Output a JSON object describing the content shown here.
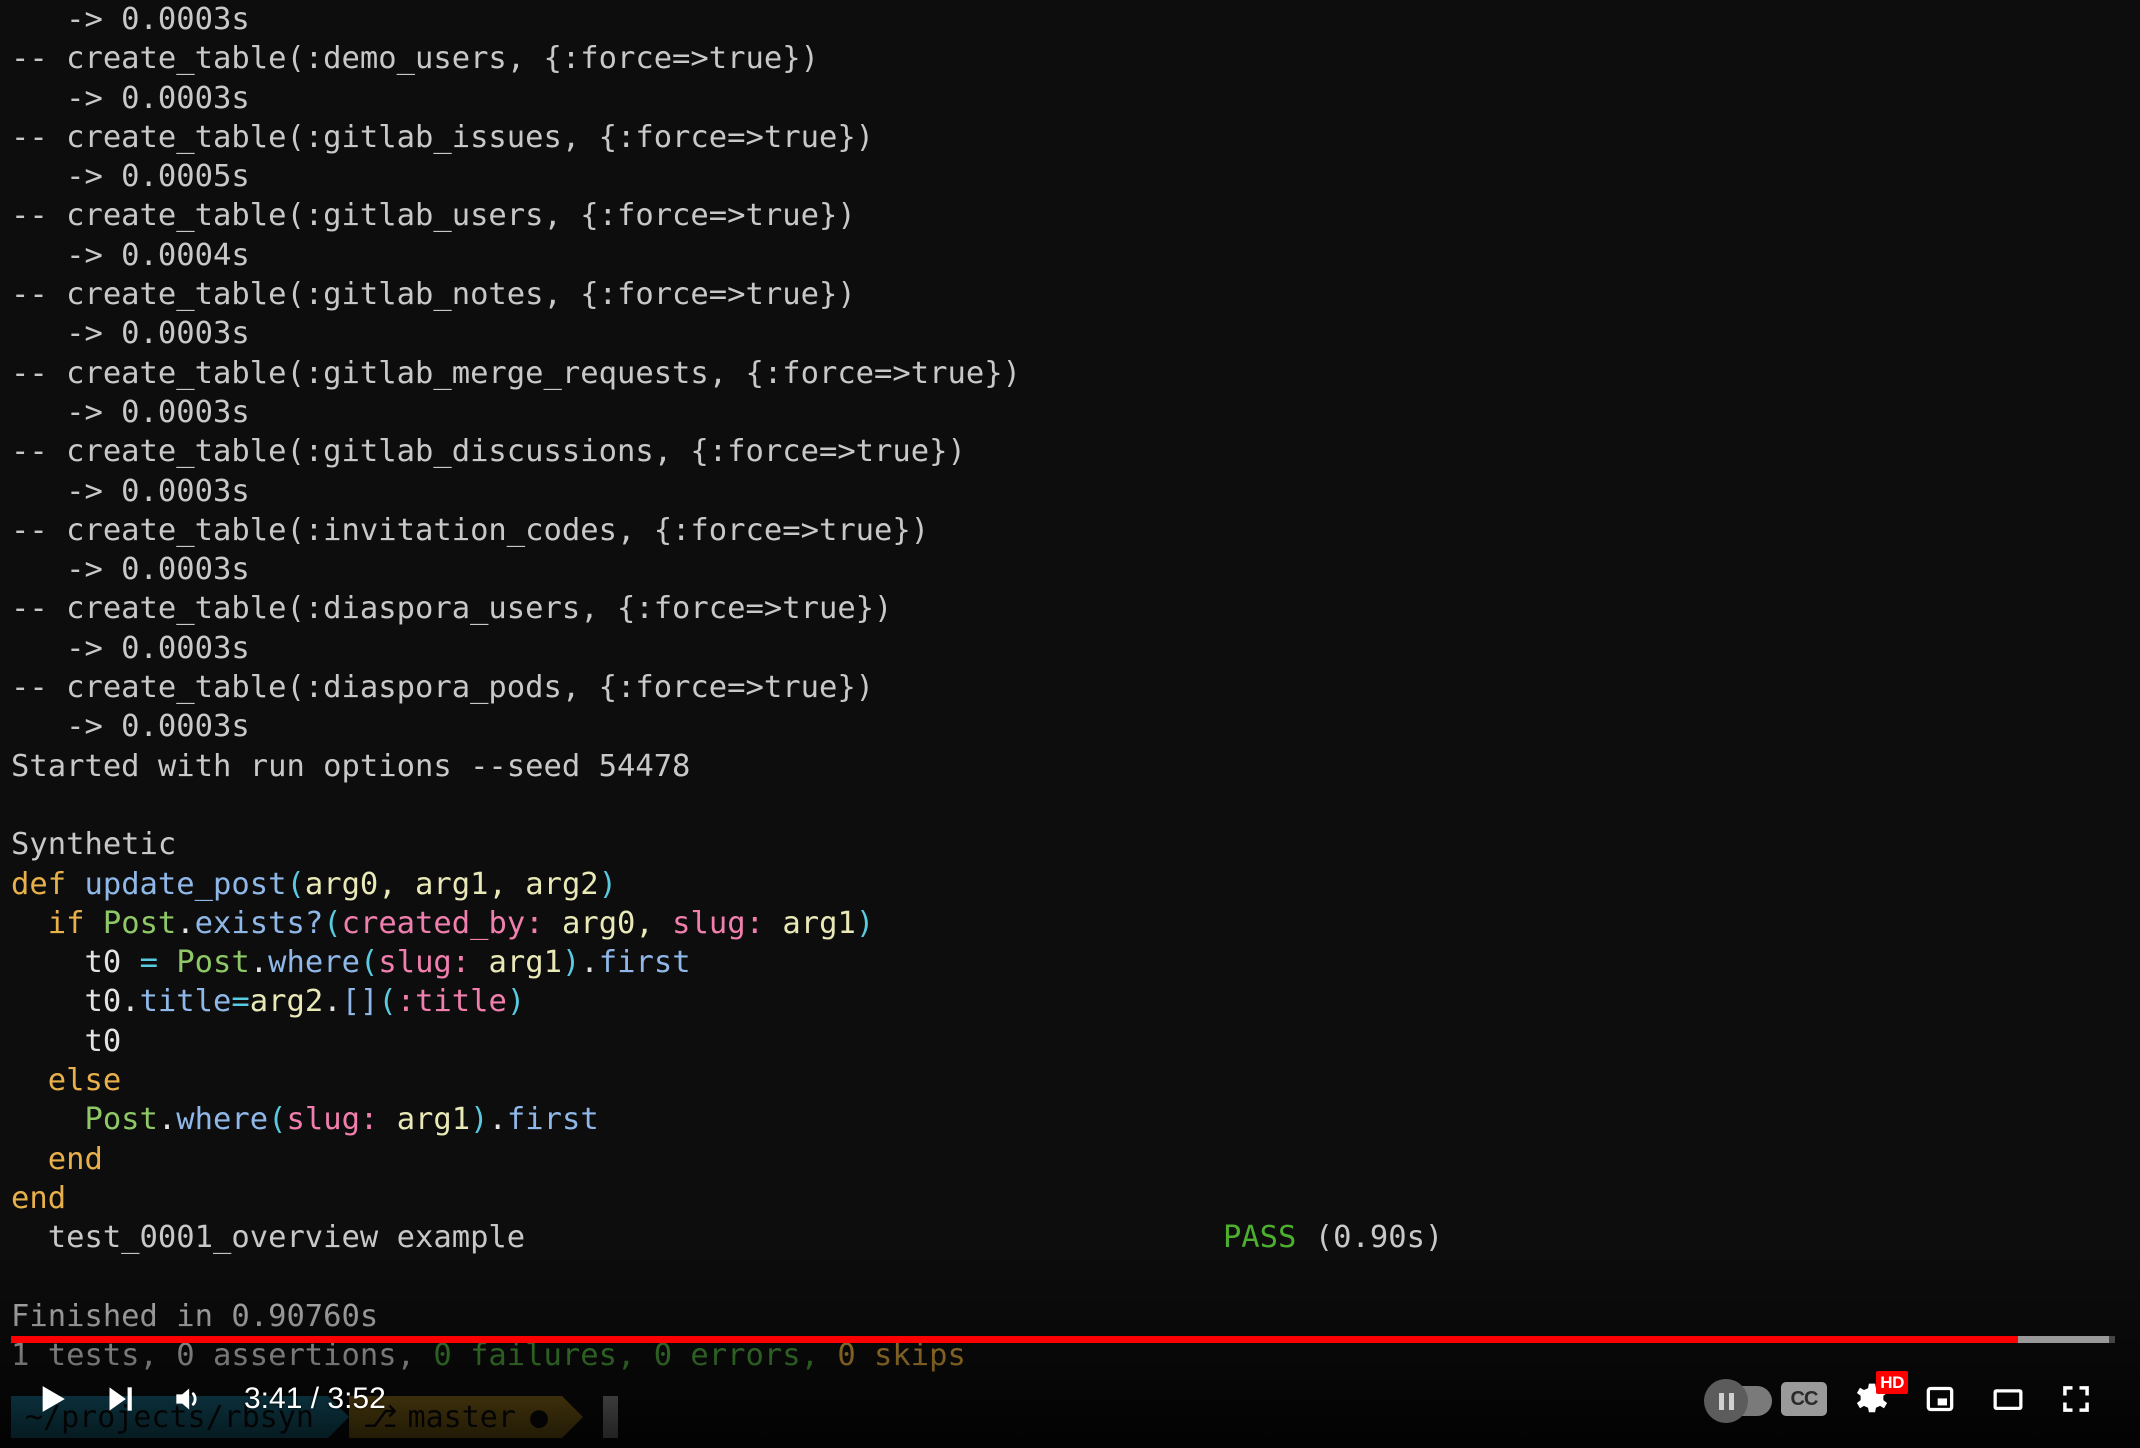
{
  "terminal": {
    "lines": [
      {
        "name": "migration-timing",
        "segments": [
          {
            "text": "   -> 0.0003s",
            "cls": "c-grey"
          }
        ]
      },
      {
        "name": "migration-create-table",
        "segments": [
          {
            "text": "-- create_table(:demo_users, {:force=>true})",
            "cls": "c-grey"
          }
        ]
      },
      {
        "name": "migration-timing",
        "segments": [
          {
            "text": "   -> 0.0003s",
            "cls": "c-grey"
          }
        ]
      },
      {
        "name": "migration-create-table",
        "segments": [
          {
            "text": "-- create_table(:gitlab_issues, {:force=>true})",
            "cls": "c-grey"
          }
        ]
      },
      {
        "name": "migration-timing",
        "segments": [
          {
            "text": "   -> 0.0005s",
            "cls": "c-grey"
          }
        ]
      },
      {
        "name": "migration-create-table",
        "segments": [
          {
            "text": "-- create_table(:gitlab_users, {:force=>true})",
            "cls": "c-grey"
          }
        ]
      },
      {
        "name": "migration-timing",
        "segments": [
          {
            "text": "   -> 0.0004s",
            "cls": "c-grey"
          }
        ]
      },
      {
        "name": "migration-create-table",
        "segments": [
          {
            "text": "-- create_table(:gitlab_notes, {:force=>true})",
            "cls": "c-grey"
          }
        ]
      },
      {
        "name": "migration-timing",
        "segments": [
          {
            "text": "   -> 0.0003s",
            "cls": "c-grey"
          }
        ]
      },
      {
        "name": "migration-create-table",
        "segments": [
          {
            "text": "-- create_table(:gitlab_merge_requests, {:force=>true})",
            "cls": "c-grey"
          }
        ]
      },
      {
        "name": "migration-timing",
        "segments": [
          {
            "text": "   -> 0.0003s",
            "cls": "c-grey"
          }
        ]
      },
      {
        "name": "migration-create-table",
        "segments": [
          {
            "text": "-- create_table(:gitlab_discussions, {:force=>true})",
            "cls": "c-grey"
          }
        ]
      },
      {
        "name": "migration-timing",
        "segments": [
          {
            "text": "   -> 0.0003s",
            "cls": "c-grey"
          }
        ]
      },
      {
        "name": "migration-create-table",
        "segments": [
          {
            "text": "-- create_table(:invitation_codes, {:force=>true})",
            "cls": "c-grey"
          }
        ]
      },
      {
        "name": "migration-timing",
        "segments": [
          {
            "text": "   -> 0.0003s",
            "cls": "c-grey"
          }
        ]
      },
      {
        "name": "migration-create-table",
        "segments": [
          {
            "text": "-- create_table(:diaspora_users, {:force=>true})",
            "cls": "c-grey"
          }
        ]
      },
      {
        "name": "migration-timing",
        "segments": [
          {
            "text": "   -> 0.0003s",
            "cls": "c-grey"
          }
        ]
      },
      {
        "name": "migration-create-table",
        "segments": [
          {
            "text": "-- create_table(:diaspora_pods, {:force=>true})",
            "cls": "c-grey"
          }
        ]
      },
      {
        "name": "migration-timing",
        "segments": [
          {
            "text": "   -> 0.0003s",
            "cls": "c-grey"
          }
        ]
      },
      {
        "name": "run-options",
        "segments": [
          {
            "text": "Started with run options --seed 54478",
            "cls": "c-grey"
          }
        ]
      },
      {
        "name": "blank-line",
        "segments": []
      },
      {
        "name": "synthetic-header",
        "segments": [
          {
            "text": "Synthetic",
            "cls": "c-grey"
          }
        ]
      },
      {
        "name": "code-line-def",
        "segments": [
          {
            "text": "def",
            "cls": "c-orange"
          },
          {
            "text": " ",
            "cls": "c-white"
          },
          {
            "text": "update_post",
            "cls": "c-blue"
          },
          {
            "text": "(",
            "cls": "c-cyan"
          },
          {
            "text": "arg0",
            "cls": "c-cream"
          },
          {
            "text": ", ",
            "cls": "c-cream"
          },
          {
            "text": "arg1",
            "cls": "c-cream"
          },
          {
            "text": ", ",
            "cls": "c-cream"
          },
          {
            "text": "arg2",
            "cls": "c-cream"
          },
          {
            "text": ")",
            "cls": "c-cyan"
          }
        ]
      },
      {
        "name": "code-line-if",
        "segments": [
          {
            "text": "  ",
            "cls": "c-white"
          },
          {
            "text": "if",
            "cls": "c-orange"
          },
          {
            "text": " ",
            "cls": "c-white"
          },
          {
            "text": "Post",
            "cls": "c-green"
          },
          {
            "text": ".",
            "cls": "c-white"
          },
          {
            "text": "exists?",
            "cls": "c-blue"
          },
          {
            "text": "(",
            "cls": "c-cyan"
          },
          {
            "text": "created_by:",
            "cls": "c-pink"
          },
          {
            "text": " ",
            "cls": "c-white"
          },
          {
            "text": "arg0",
            "cls": "c-cream"
          },
          {
            "text": ", ",
            "cls": "c-cream"
          },
          {
            "text": "slug:",
            "cls": "c-pink"
          },
          {
            "text": " ",
            "cls": "c-white"
          },
          {
            "text": "arg1",
            "cls": "c-cream"
          },
          {
            "text": ")",
            "cls": "c-cyan"
          }
        ]
      },
      {
        "name": "code-line-assign",
        "segments": [
          {
            "text": "    ",
            "cls": "c-white"
          },
          {
            "text": "t0",
            "cls": "c-white"
          },
          {
            "text": " ",
            "cls": "c-white"
          },
          {
            "text": "=",
            "cls": "c-cyan"
          },
          {
            "text": " ",
            "cls": "c-white"
          },
          {
            "text": "Post",
            "cls": "c-green"
          },
          {
            "text": ".",
            "cls": "c-white"
          },
          {
            "text": "where",
            "cls": "c-blue"
          },
          {
            "text": "(",
            "cls": "c-cyan"
          },
          {
            "text": "slug:",
            "cls": "c-pink"
          },
          {
            "text": " ",
            "cls": "c-white"
          },
          {
            "text": "arg1",
            "cls": "c-cream"
          },
          {
            "text": ")",
            "cls": "c-cyan"
          },
          {
            "text": ".",
            "cls": "c-white"
          },
          {
            "text": "first",
            "cls": "c-blue"
          }
        ]
      },
      {
        "name": "code-line-title",
        "segments": [
          {
            "text": "    ",
            "cls": "c-white"
          },
          {
            "text": "t0",
            "cls": "c-white"
          },
          {
            "text": ".",
            "cls": "c-white"
          },
          {
            "text": "title",
            "cls": "c-blue"
          },
          {
            "text": "=",
            "cls": "c-cyan"
          },
          {
            "text": "arg2",
            "cls": "c-cream"
          },
          {
            "text": ".",
            "cls": "c-white"
          },
          {
            "text": "[]",
            "cls": "c-blue"
          },
          {
            "text": "(",
            "cls": "c-cyan"
          },
          {
            "text": ":title",
            "cls": "c-pink"
          },
          {
            "text": ")",
            "cls": "c-cyan"
          }
        ]
      },
      {
        "name": "code-line-t0",
        "segments": [
          {
            "text": "    ",
            "cls": "c-white"
          },
          {
            "text": "t0",
            "cls": "c-white"
          }
        ]
      },
      {
        "name": "code-line-else",
        "segments": [
          {
            "text": "  ",
            "cls": "c-white"
          },
          {
            "text": "else",
            "cls": "c-orange"
          }
        ]
      },
      {
        "name": "code-line-post-where",
        "segments": [
          {
            "text": "    ",
            "cls": "c-white"
          },
          {
            "text": "Post",
            "cls": "c-green"
          },
          {
            "text": ".",
            "cls": "c-white"
          },
          {
            "text": "where",
            "cls": "c-blue"
          },
          {
            "text": "(",
            "cls": "c-cyan"
          },
          {
            "text": "slug:",
            "cls": "c-pink"
          },
          {
            "text": " ",
            "cls": "c-white"
          },
          {
            "text": "arg1",
            "cls": "c-cream"
          },
          {
            "text": ")",
            "cls": "c-cyan"
          },
          {
            "text": ".",
            "cls": "c-white"
          },
          {
            "text": "first",
            "cls": "c-blue"
          }
        ]
      },
      {
        "name": "code-line-end-inner",
        "segments": [
          {
            "text": "  ",
            "cls": "c-white"
          },
          {
            "text": "end",
            "cls": "c-orange"
          }
        ]
      },
      {
        "name": "code-line-end-outer",
        "segments": [
          {
            "text": "end",
            "cls": "c-orange"
          }
        ]
      },
      {
        "name": "test-result-line",
        "segments": [
          {
            "text": "  test_0001_overview example",
            "cls": "c-grey"
          },
          {
            "text": "                                      ",
            "cls": "c-grey"
          },
          {
            "text": "PASS",
            "cls": "c-passg"
          },
          {
            "text": " (0.90s)",
            "cls": "c-grey"
          }
        ]
      },
      {
        "name": "blank-line",
        "segments": []
      },
      {
        "name": "finished-line",
        "segments": [
          {
            "text": "Finished in 0.90760s",
            "cls": "c-grey"
          }
        ]
      },
      {
        "name": "test-summary-line",
        "segments": [
          {
            "text": "1 tests, 0 assertions, ",
            "cls": "c-grey"
          },
          {
            "text": "0 failures, 0 errors, ",
            "cls": "c-statg"
          },
          {
            "text": "0 skips",
            "cls": "c-yellow"
          }
        ]
      }
    ],
    "prompt": {
      "path": "~/projects/rbsyn",
      "branch_icon": "⎇",
      "branch": "master",
      "dirty_marker": "●",
      "path_bg": "#186d88",
      "branch_bg": "#8d6d19"
    }
  },
  "player": {
    "progress": {
      "played_percent": 95.4,
      "loaded_percent": 99.7,
      "played_color": "#ff0000"
    },
    "time": {
      "current": "3:41",
      "duration": "3:52",
      "display": "3:41 / 3:52"
    },
    "left_controls": [
      {
        "name": "play-icon",
        "label": "Play"
      },
      {
        "name": "next-video-icon",
        "label": "Next"
      },
      {
        "name": "volume-icon",
        "label": "Mute"
      }
    ],
    "right_controls": [
      {
        "name": "autoplay-toggle",
        "label": "Autoplay",
        "state": "off"
      },
      {
        "name": "subtitles-icon",
        "label": "CC"
      },
      {
        "name": "settings-gear-icon",
        "label": "Settings",
        "badge": "HD"
      },
      {
        "name": "miniplayer-icon",
        "label": "Miniplayer"
      },
      {
        "name": "theater-mode-icon",
        "label": "Theater mode"
      },
      {
        "name": "fullscreen-icon",
        "label": "Full screen"
      }
    ]
  }
}
